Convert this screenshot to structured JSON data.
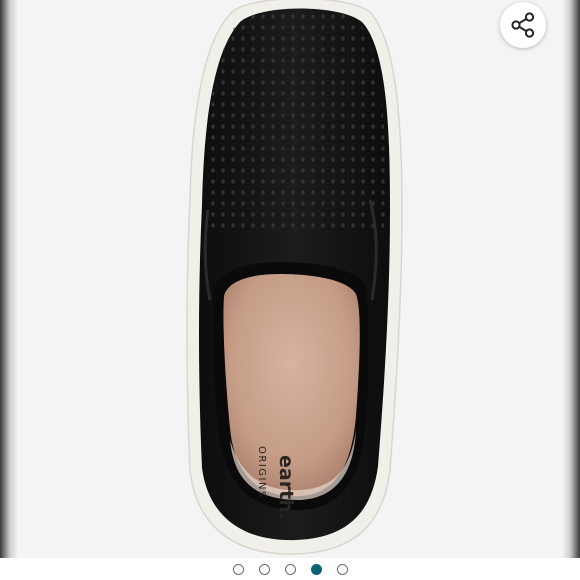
{
  "product_image": {
    "brand_wordmark": "earth.",
    "brand_subtitle": "ORIGINS",
    "colors": {
      "upper": "#141414",
      "sole": "#f1efe9",
      "insole": "#c9a390"
    }
  },
  "share_button": {
    "icon": "share-icon"
  },
  "carousel": {
    "total": 5,
    "active_index": 3,
    "accent_color": "#0e6170"
  }
}
